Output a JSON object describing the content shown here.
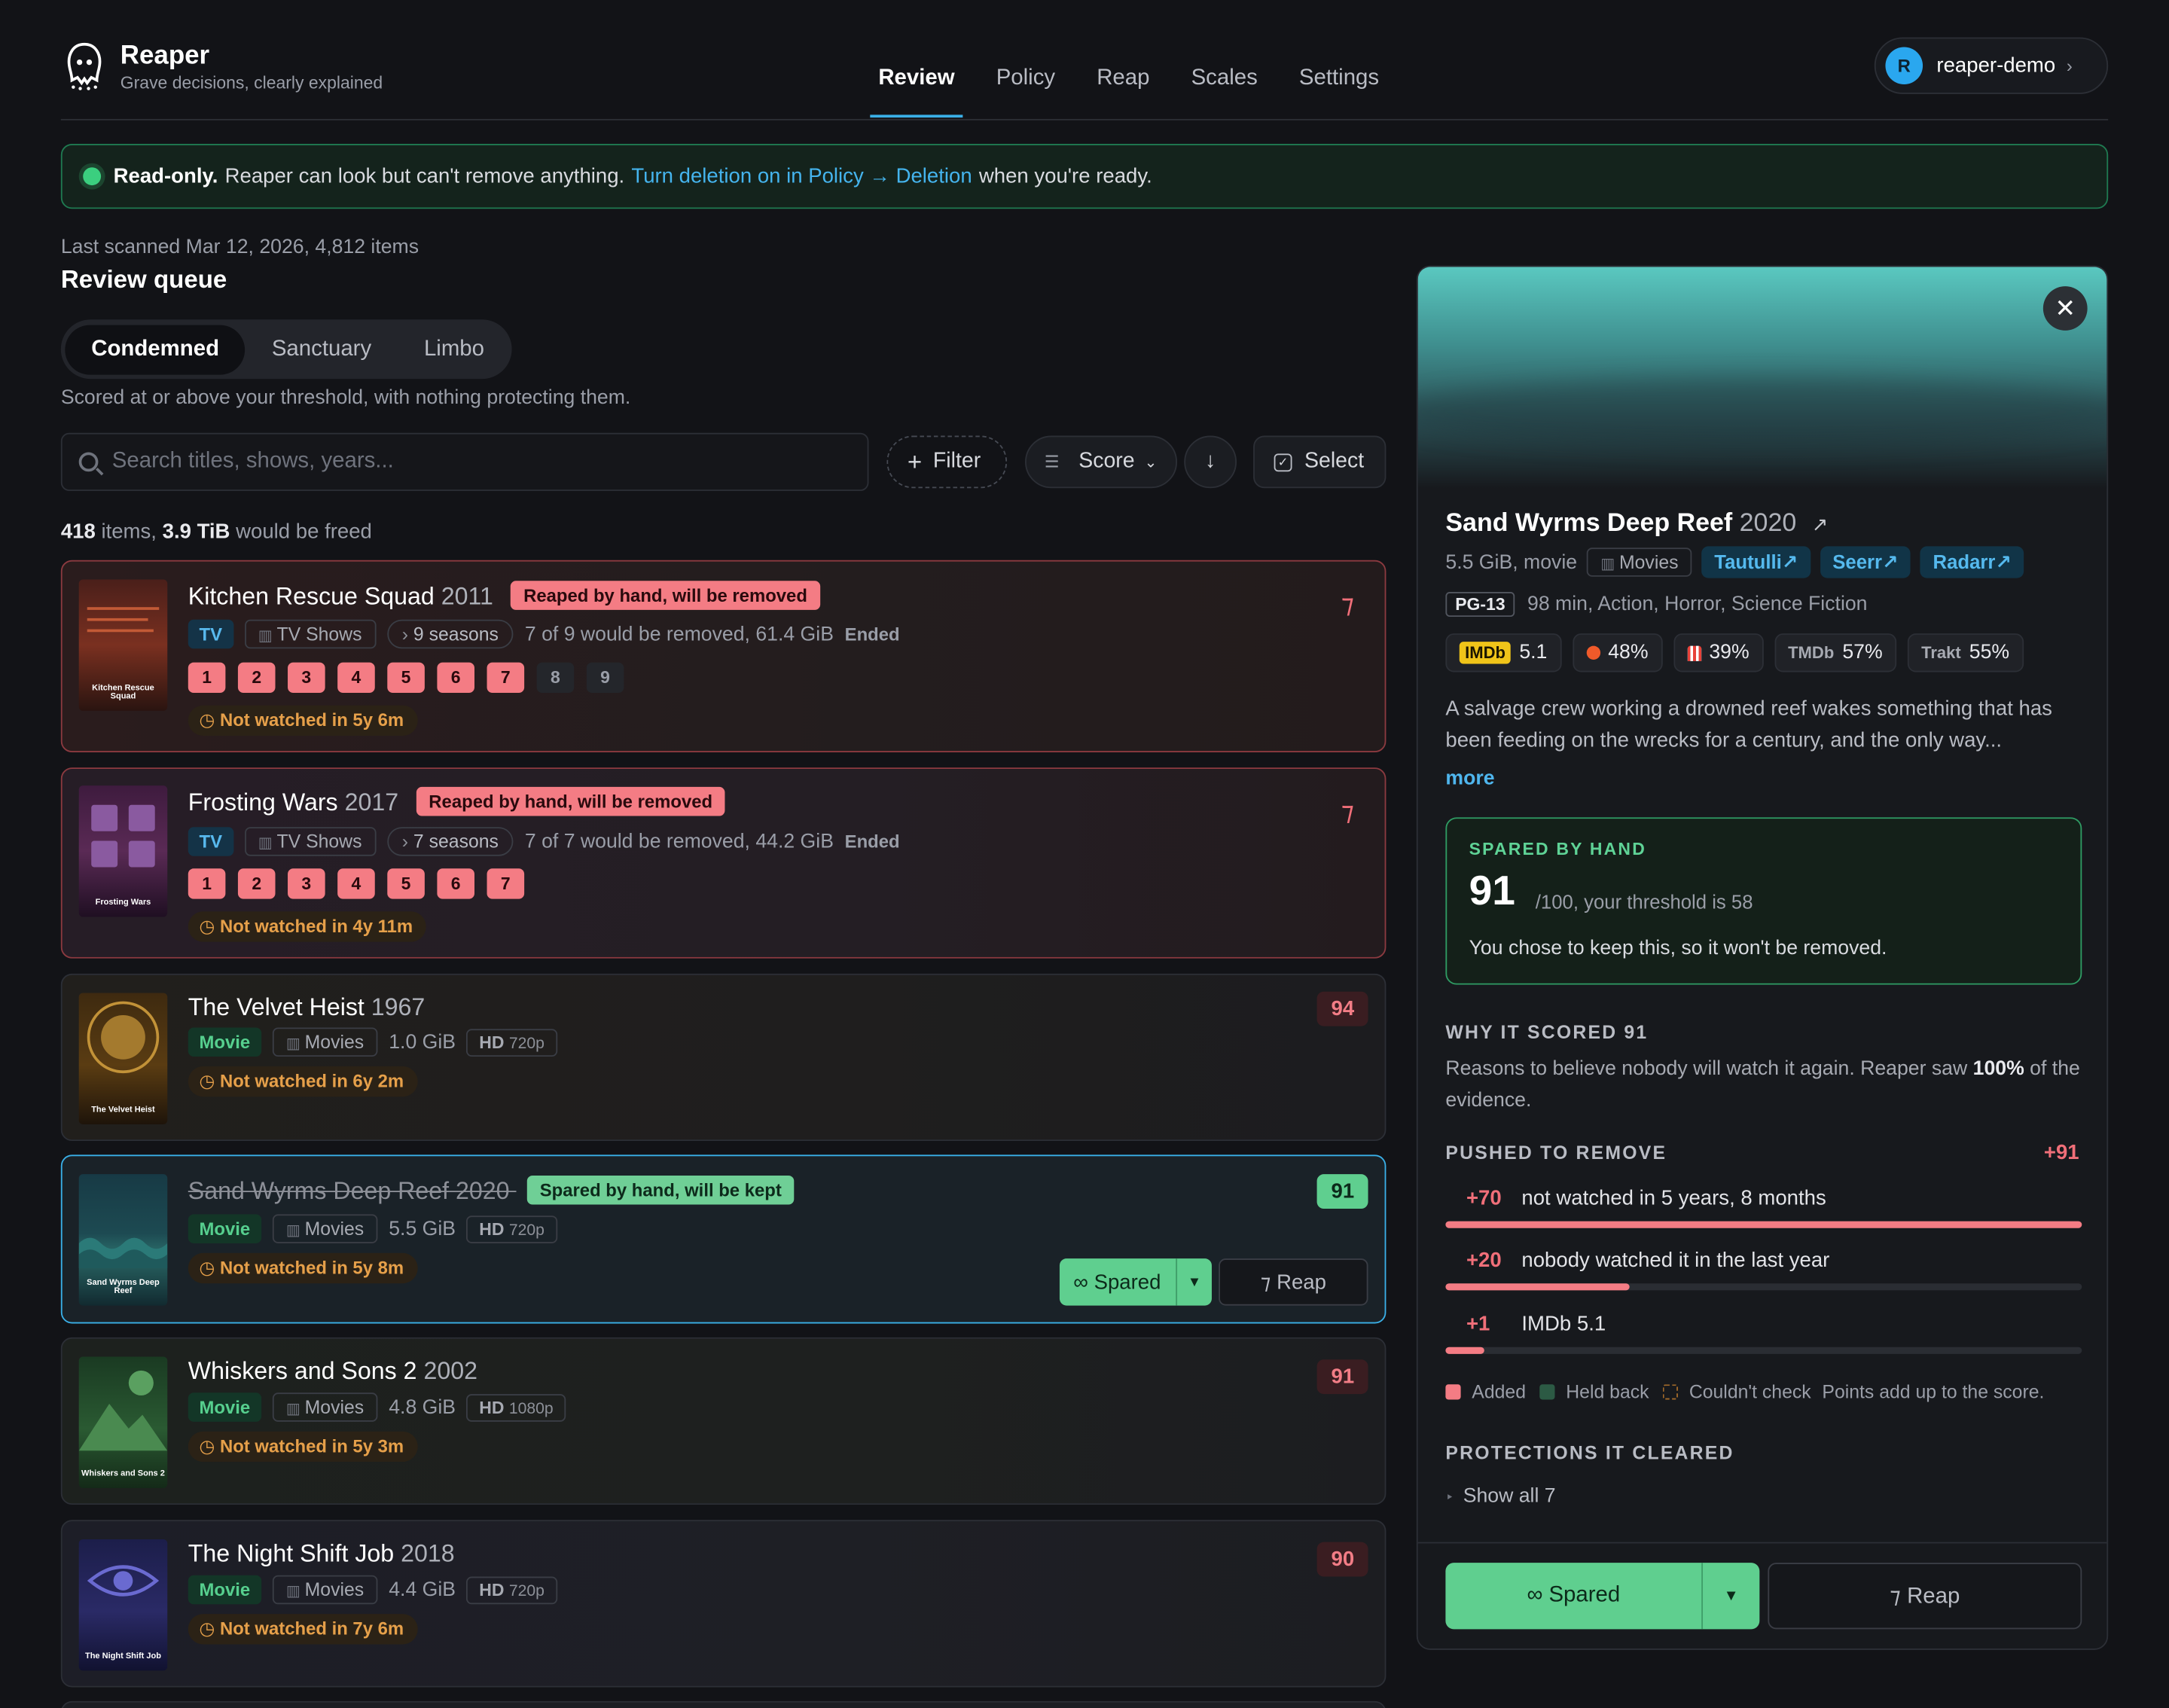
{
  "app": {
    "name": "Reaper",
    "tagline": "Grave decisions, clearly explained"
  },
  "nav": [
    "Review",
    "Policy",
    "Reap",
    "Scales",
    "Settings"
  ],
  "user": {
    "initial": "R",
    "name": "reaper-demo"
  },
  "banner": {
    "strong": "Read-only.",
    "text": "Reaper can look but can't remove anything.",
    "link": "Turn deletion on in Policy → Deletion",
    "tail": "when you're ready."
  },
  "meta": "Last scanned Mar 12, 2026, 4,812 items",
  "queue_title": "Review queue",
  "segments": [
    "Condemned",
    "Sanctuary",
    "Limbo"
  ],
  "segment_desc": "Scored at or above your threshold, with nothing protecting them.",
  "search_placeholder": "Search titles, shows, years...",
  "toolbar": {
    "filter": "Filter",
    "score": "Score",
    "select": "Select"
  },
  "summary": {
    "items": "418",
    "items_label": "items,",
    "size": "3.9 TiB",
    "size_label": "would be freed"
  },
  "rows": [
    {
      "title": "Kitchen Rescue Squad",
      "year": "2011",
      "tag": "Reaped by hand, will be removed",
      "kind": "TV",
      "library": "TV Shows",
      "seasons": "9 seasons",
      "detail": "7 of 9 would be removed, 61.4 GiB",
      "status": "Ended",
      "season_numbers": [
        "1",
        "2",
        "3",
        "4",
        "5",
        "6",
        "7",
        "8",
        "9"
      ],
      "unwatched": "Not watched in 5y 6m",
      "score": "⁊",
      "poster_title": "Kitchen Rescue Squad"
    },
    {
      "title": "Frosting Wars",
      "year": "2017",
      "tag": "Reaped by hand, will be removed",
      "kind": "TV",
      "library": "TV Shows",
      "seasons": "7 seasons",
      "detail": "7 of 7 would be removed, 44.2 GiB",
      "status": "Ended",
      "season_numbers": [
        "1",
        "2",
        "3",
        "4",
        "5",
        "6",
        "7"
      ],
      "unwatched": "Not watched in 4y 11m",
      "score": "⁊",
      "poster_title": "Frosting Wars"
    },
    {
      "title": "The Velvet Heist",
      "year": "1967",
      "kind": "Movie",
      "library": "Movies",
      "size": "1.0 GiB",
      "quality": "HD",
      "resolution": "720p",
      "unwatched": "Not watched in 6y 2m",
      "score": "94",
      "poster_title": "The Velvet Heist"
    },
    {
      "title": "Sand Wyrms Deep Reef",
      "year": "2020",
      "tag": "Spared by hand, will be kept",
      "kind": "Movie",
      "library": "Movies",
      "size": "5.5 GiB",
      "quality": "HD",
      "resolution": "720p",
      "unwatched": "Not watched in 5y 8m",
      "score": "91",
      "spared_label": "∞ Spared",
      "reap_label": "⁊ Reap",
      "poster_title": "Sand Wyrms Deep Reef"
    },
    {
      "title": "Whiskers and Sons 2",
      "year": "2002",
      "kind": "Movie",
      "library": "Movies",
      "size": "4.8 GiB",
      "quality": "HD",
      "resolution": "1080p",
      "unwatched": "Not watched in 5y 3m",
      "score": "91",
      "poster_title": "Whiskers and Sons 2"
    },
    {
      "title": "The Night Shift Job",
      "year": "2018",
      "kind": "Movie",
      "library": "Movies",
      "size": "4.4 GiB",
      "quality": "HD",
      "resolution": "720p",
      "unwatched": "Not watched in 7y 6m",
      "score": "90",
      "poster_title": "The Night Shift Job"
    }
  ],
  "detail": {
    "title": "Sand Wyrms Deep Reef",
    "year": "2020",
    "ext": "↗",
    "size_kind": "5.5 GiB, movie",
    "library": "Movies",
    "links": [
      "Tautulli↗",
      "Seerr↗",
      "Radarr↗"
    ],
    "rating": "PG-13",
    "info": "98 min, Action, Horror, Science Fiction",
    "ratings": {
      "imdb_label": "IMDb",
      "imdb": "5.1",
      "rt_critics": "48%",
      "rt_audience": "39%",
      "tmdb_label": "TMDb",
      "tmdb": "57%",
      "trakt_label": "Trakt",
      "trakt": "55%"
    },
    "description": "A salvage crew working a drowned reef wakes something that has been feeding on the wrecks for a century, and the only way...",
    "more": "more",
    "spared": {
      "label": "SPARED BY HAND",
      "score": "91",
      "threshold": "/100, your threshold is 58",
      "note": "You chose to keep this, so it won't be removed."
    },
    "why_title": "WHY IT SCORED 91",
    "why_text": "Reasons to believe nobody will watch it again. Reaper saw",
    "evidence": "100%",
    "why_tail": "of the evidence.",
    "pushed_title": "PUSHED TO REMOVE",
    "pushed_total": "+91",
    "reasons": [
      {
        "points": "+70",
        "text": "not watched in 5 years, 8 months",
        "fill": 1.0
      },
      {
        "points": "+20",
        "text": "nobody watched it in the last year",
        "fill": 0.29
      },
      {
        "points": "+1",
        "text": "IMDb 5.1",
        "fill": 0.06
      }
    ],
    "legend": {
      "added": "Added",
      "held": "Held back",
      "unknown": "Couldn't check",
      "note": "Points add up to the score."
    },
    "protections_title": "PROTECTIONS IT CLEARED",
    "show_all": "Show all 7",
    "spared_label": "∞ Spared",
    "reap_label": "⁊ Reap"
  },
  "colors": {
    "accent": "#3ab0e8",
    "danger": "#f47c84",
    "spared": "#5fcf8f"
  }
}
